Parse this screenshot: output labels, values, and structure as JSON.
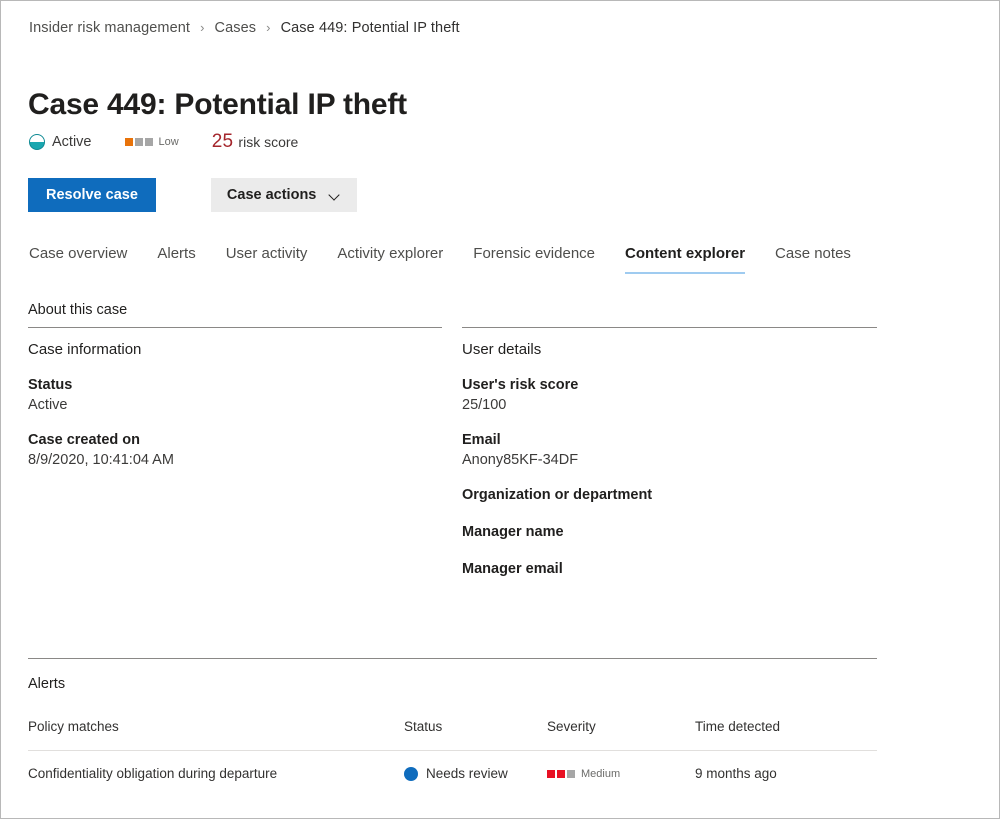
{
  "breadcrumb": {
    "items": [
      {
        "label": "Insider risk management"
      },
      {
        "label": "Cases"
      },
      {
        "label": "Case 449: Potential IP theft"
      }
    ],
    "separator": "›"
  },
  "header": {
    "title": "Case 449: Potential IP theft",
    "status_text": "Active",
    "severity_label": "Low",
    "severity_level": 1,
    "risk_score_number": "25",
    "risk_score_label": "risk score",
    "status_icon": "half-filled-circle-icon",
    "colors": {
      "status_icon": "#1aa7b0",
      "severity_on": "#e8730a",
      "severity_off": "#a6a6a6",
      "risk_score": "#a4262c",
      "primary_button": "#0f6cbd",
      "tab_underline": "#9fcbf0"
    }
  },
  "toolbar": {
    "resolve_label": "Resolve case",
    "case_actions_label": "Case actions",
    "case_actions_icon": "chevron-down-icon"
  },
  "tabs": [
    {
      "label": "Case overview",
      "active": false
    },
    {
      "label": "Alerts",
      "active": false
    },
    {
      "label": "User activity",
      "active": false
    },
    {
      "label": "Activity explorer",
      "active": false
    },
    {
      "label": "Forensic evidence",
      "active": false
    },
    {
      "label": "Content explorer",
      "active": true
    },
    {
      "label": "Case notes",
      "active": false
    }
  ],
  "about": {
    "section_label": "About this case",
    "case_information": {
      "heading": "Case information",
      "fields": [
        {
          "label": "Status",
          "value": "Active"
        },
        {
          "label": "Case created on",
          "value": "8/9/2020, 10:41:04 AM"
        }
      ]
    },
    "user_details": {
      "heading": "User details",
      "fields": [
        {
          "label": "User's risk score",
          "value": "25/100"
        },
        {
          "label": "Email",
          "value": "Anony85KF-34DF"
        },
        {
          "label": "Organization or department",
          "value": ""
        },
        {
          "label": "Manager name",
          "value": ""
        },
        {
          "label": "Manager email",
          "value": ""
        }
      ]
    }
  },
  "alerts": {
    "title": "Alerts",
    "columns": [
      "Policy matches",
      "Status",
      "Severity",
      "Time detected"
    ],
    "rows": [
      {
        "policy": "Confidentiality obligation during departure",
        "status": "Needs review",
        "status_icon": "filled-circle-icon",
        "severity": "Medium",
        "severity_level": 2,
        "time": "9 months ago"
      }
    ]
  }
}
